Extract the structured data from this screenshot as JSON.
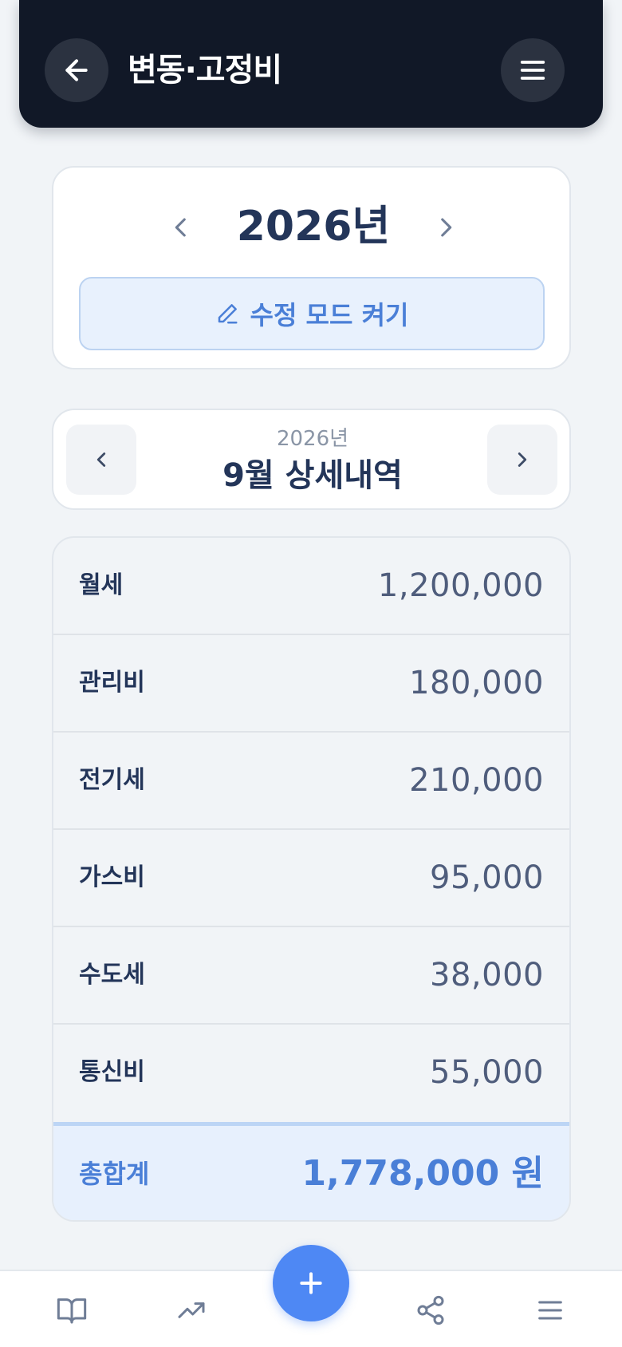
{
  "header": {
    "title": "변동·고정비",
    "back_icon": "arrow-left-icon",
    "menu_icon": "hamburger-menu-icon"
  },
  "year_selector": {
    "year_label": "2026년",
    "edit_button_label": "수정 모드 켜기",
    "edit_icon": "pencil-icon"
  },
  "month_header": {
    "year": "2026년",
    "title": "9월 상세내역"
  },
  "expenses": [
    {
      "label": "월세",
      "amount": "1,200,000"
    },
    {
      "label": "관리비",
      "amount": "180,000"
    },
    {
      "label": "전기세",
      "amount": "210,000"
    },
    {
      "label": "가스비",
      "amount": "95,000"
    },
    {
      "label": "수도세",
      "amount": "38,000"
    },
    {
      "label": "통신비",
      "amount": "55,000"
    }
  ],
  "total": {
    "label": "총합계",
    "amount": "1,778,000 원"
  },
  "bottom_nav": {
    "items": [
      "book-icon",
      "trending-up-icon",
      "plus-icon",
      "share-icon",
      "menu-icon"
    ]
  },
  "colors": {
    "header_bg": "#111827",
    "accent": "#4e88f4",
    "total_text": "#4a7fd7",
    "page_bg": "#f1f4f7"
  }
}
